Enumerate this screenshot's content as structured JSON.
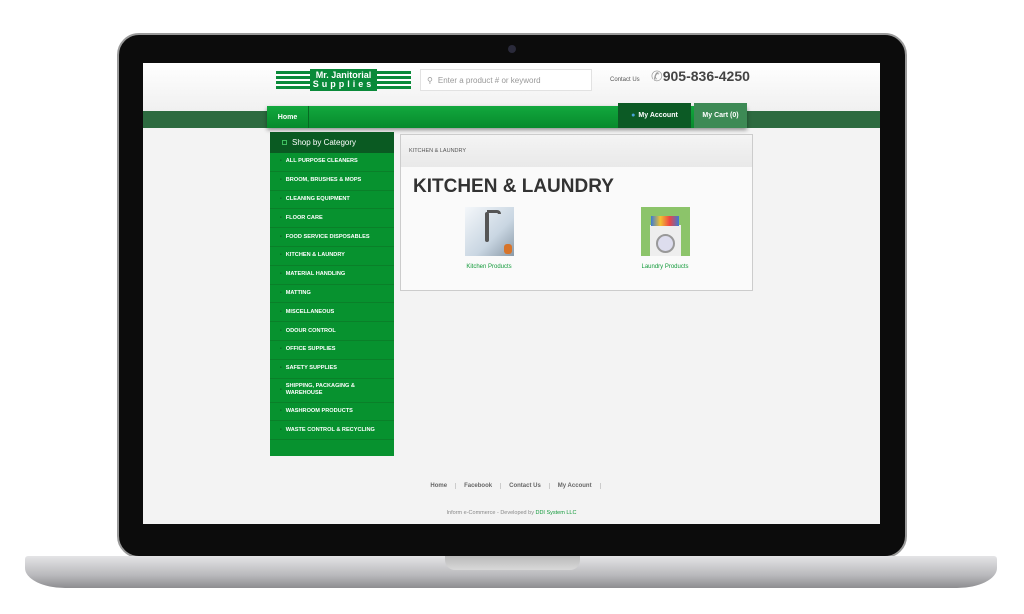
{
  "header": {
    "logo_line1": "Mr. Janitorial",
    "logo_line2": "Supplies",
    "search_placeholder": "Enter a product # or keyword",
    "contact": "Contact Us",
    "phone": "905-836-4250"
  },
  "nav": {
    "home": "Home",
    "account": "My Account",
    "cart": "My Cart (0)"
  },
  "sidebar": {
    "title": "Shop by Category",
    "items": [
      "ALL PURPOSE CLEANERS",
      "BROOM, BRUSHES & MOPS",
      "CLEANING EQUIPMENT",
      "FLOOR CARE",
      "FOOD SERVICE DISPOSABLES",
      "KITCHEN & LAUNDRY",
      "MATERIAL HANDLING",
      "MATTING",
      "MISCELLANEOUS",
      "ODOUR CONTROL",
      "OFFICE SUPPLIES",
      "SAFETY SUPPLIES",
      "SHIPPING, PACKAGING & WAREHOUSE",
      "WASHROOM PRODUCTS",
      "WASTE CONTROL & RECYCLING"
    ]
  },
  "content": {
    "breadcrumb": "KITCHEN & LAUNDRY",
    "title": "KITCHEN & LAUNDRY",
    "products": [
      "Kitchen Products",
      "Laundry Products"
    ]
  },
  "footer": {
    "links": [
      "Home",
      "Facebook",
      "Contact Us",
      "My Account"
    ],
    "credit_prefix": "Inform e-Commerce - Developed by",
    "credit_link": "DDI System LLC"
  }
}
